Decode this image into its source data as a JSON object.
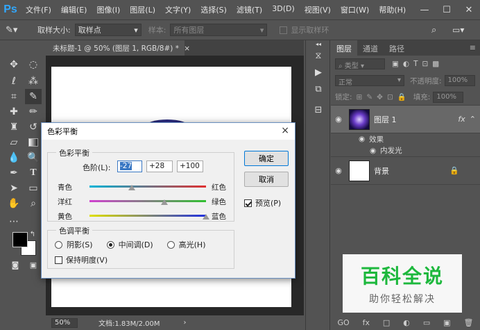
{
  "app": {
    "logo": "Ps",
    "accent": "#31a8ff"
  },
  "menu": [
    "文件(F)",
    "编辑(E)",
    "图像(I)",
    "图层(L)",
    "文字(Y)",
    "选择(S)",
    "滤镜(T)",
    "3D(D)",
    "视图(V)",
    "窗口(W)",
    "帮助(H)"
  ],
  "window_buttons": [
    "—",
    "☐",
    "✕"
  ],
  "options": {
    "sample_size_label": "取样大小:",
    "sample_size_value": "取样点",
    "sample_label": "样本:",
    "sample_value": "所有图层",
    "show_ring_label": "显示取样环"
  },
  "doc_tab": {
    "title": "未标题-1 @ 50% (图层 1, RGB/8#) *",
    "close": "×"
  },
  "status": {
    "zoom": "50%",
    "doc_info": "文档:1.83M/2.00M"
  },
  "layers_panel": {
    "tabs": [
      "图层",
      "通道",
      "路径"
    ],
    "kind_label": "类型",
    "blend_mode": "正常",
    "opacity_label": "不透明度:",
    "opacity_value": "100%",
    "lock_label": "锁定:",
    "fill_label": "填充:",
    "fill_value": "100%",
    "layer1_name": "图层 1",
    "fx_badge": "fx",
    "effects_label": "效果",
    "inner_glow_label": "内发光",
    "bg_name": "背景",
    "footer_icons": [
      "GO",
      "fx",
      "□",
      "◐",
      "▭",
      "▣",
      "🗑"
    ]
  },
  "dialog": {
    "title": "色彩平衡",
    "close": "×",
    "balance_group": "色彩平衡",
    "levels_label": "色阶(L):",
    "levels": [
      "-27",
      "+28",
      "+100"
    ],
    "sliders": [
      {
        "left": "青色",
        "right": "红色",
        "value": -27,
        "colors": [
          "#00b4d8",
          "#e03030"
        ]
      },
      {
        "left": "洋红",
        "right": "绿色",
        "value": 28,
        "colors": [
          "#d040d0",
          "#30c030"
        ]
      },
      {
        "left": "黄色",
        "right": "蓝色",
        "value": 100,
        "colors": [
          "#e0e000",
          "#2030e0"
        ]
      }
    ],
    "tone_group": "色调平衡",
    "tone_options": [
      "阴影(S)",
      "中间调(D)",
      "高光(H)"
    ],
    "tone_selected": 1,
    "preserve_label": "保持明度(V)",
    "ok_label": "确定",
    "cancel_label": "取消",
    "preview_label": "预览(P)",
    "preview_checked": true
  },
  "watermark": {
    "title": "百科全说",
    "subtitle": "助你轻松解决",
    "color": "#1db83d"
  }
}
